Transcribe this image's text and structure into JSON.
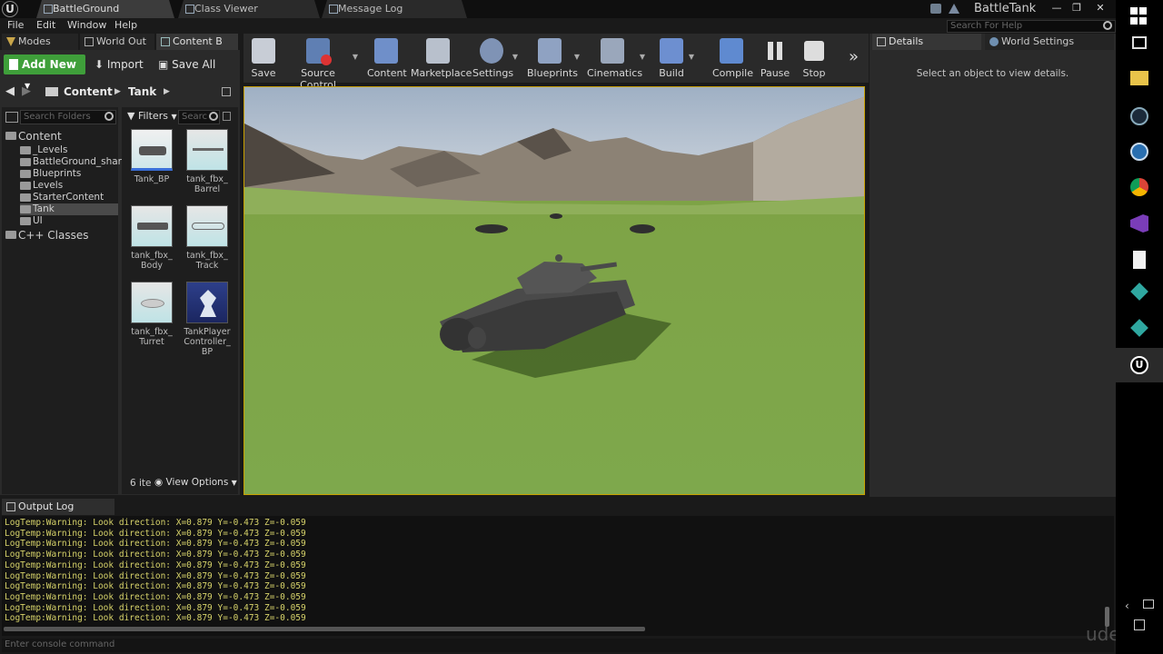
{
  "titlebar": {
    "tabs": [
      {
        "label": "BattleGround",
        "active": true
      },
      {
        "label": "Class Viewer",
        "active": false
      },
      {
        "label": "Message Log",
        "active": false
      }
    ],
    "project_name": "BattleTank",
    "window_buttons": [
      "—",
      "❐",
      "✕"
    ]
  },
  "menubar": {
    "items": [
      "File",
      "Edit",
      "Window",
      "Help"
    ],
    "search_placeholder": "Search For Help"
  },
  "left_tabs": [
    {
      "label": "Modes"
    },
    {
      "label": "World Out"
    },
    {
      "label": "Content B"
    }
  ],
  "content_browser": {
    "add_new": "Add New",
    "import": "Import",
    "save_all": "Save All",
    "path": [
      "Content",
      "Tank"
    ],
    "search_folders_placeholder": "Search Folders",
    "filters": "Filters",
    "search_assets_placeholder": "Searc",
    "tree": [
      {
        "label": "Content",
        "level": 0,
        "selected": false
      },
      {
        "label": "_Levels",
        "level": 1,
        "selected": false
      },
      {
        "label": "BattleGround_shar",
        "level": 1,
        "selected": false
      },
      {
        "label": "Blueprints",
        "level": 1,
        "selected": false
      },
      {
        "label": "Levels",
        "level": 1,
        "selected": false
      },
      {
        "label": "StarterContent",
        "level": 1,
        "selected": false
      },
      {
        "label": "Tank",
        "level": 1,
        "selected": true
      },
      {
        "label": "UI",
        "level": 1,
        "selected": false
      },
      {
        "label": "C++ Classes",
        "level": 0,
        "selected": false
      }
    ],
    "assets": [
      {
        "label": "Tank_BP"
      },
      {
        "label": "tank_fbx_\nBarrel"
      },
      {
        "label": "tank_fbx_\nBody"
      },
      {
        "label": "tank_fbx_\nTrack"
      },
      {
        "label": "tank_fbx_\nTurret"
      },
      {
        "label": "TankPlayer\nController_\nBP"
      }
    ],
    "item_count": "6 ite",
    "view_options": "View Options"
  },
  "toolbar": {
    "buttons": [
      {
        "label": "Save",
        "color": "#c8cdd6"
      },
      {
        "label": "Source Control",
        "color": "#5f7fb3"
      },
      {
        "label": "Content",
        "color": "#6f8fc9"
      },
      {
        "label": "Marketplace",
        "color": "#b8c0cc"
      },
      {
        "label": "Settings",
        "color": "#7f93b5"
      },
      {
        "label": "Blueprints",
        "color": "#8fa2c2"
      },
      {
        "label": "Cinematics",
        "color": "#9aa7bb"
      },
      {
        "label": "Build",
        "color": "#6d8fd0"
      },
      {
        "label": "Compile",
        "color": "#5f8ad0"
      },
      {
        "label": "Pause",
        "color": "#dddddd"
      },
      {
        "label": "Stop",
        "color": "#dddddd"
      }
    ],
    "overflow": "»"
  },
  "details": {
    "tabs": [
      {
        "label": "Details",
        "active": true
      },
      {
        "label": "World Settings",
        "active": false
      }
    ],
    "empty_message": "Select an object to view details."
  },
  "output_log": {
    "tab_label": "Output Log",
    "lines": [
      "LogTemp:Warning: Look direction: X=0.879 Y=-0.473 Z=-0.059",
      "LogTemp:Warning: Look direction: X=0.879 Y=-0.473 Z=-0.059",
      "LogTemp:Warning: Look direction: X=0.879 Y=-0.473 Z=-0.059",
      "LogTemp:Warning: Look direction: X=0.879 Y=-0.473 Z=-0.059",
      "LogTemp:Warning: Look direction: X=0.879 Y=-0.473 Z=-0.059",
      "LogTemp:Warning: Look direction: X=0.879 Y=-0.473 Z=-0.059",
      "LogTemp:Warning: Look direction: X=0.879 Y=-0.473 Z=-0.059",
      "LogTemp:Warning: Look direction: X=0.879 Y=-0.473 Z=-0.059",
      "LogTemp:Warning: Look direction: X=0.879 Y=-0.473 Z=-0.059",
      "LogTemp:Warning: Look direction: X=0.879 Y=-0.473 Z=-0.059"
    ],
    "console_placeholder": "Enter console command"
  },
  "watermark": "udemy",
  "taskbar_icons": [
    "windows-icon",
    "task-view-icon",
    "file-explorer-icon",
    "steam-icon",
    "app-icon",
    "chrome-icon",
    "visual-studio-icon",
    "document-icon",
    "gem-icon",
    "gem-icon-2",
    "unreal-icon"
  ]
}
